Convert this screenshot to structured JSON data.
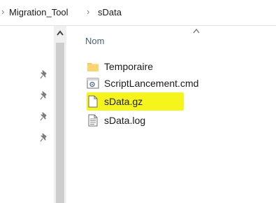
{
  "breadcrumb": {
    "items": [
      "Migration_Tool",
      "sData"
    ],
    "separator": "›"
  },
  "column_header": {
    "label": "Nom"
  },
  "files": [
    {
      "name": "Temporaire",
      "type": "folder-icon"
    },
    {
      "name": "ScriptLancement.cmd",
      "type": "cmd-file-icon"
    },
    {
      "name": "sData.gz",
      "type": "blank-file-icon",
      "highlighted": true
    },
    {
      "name": "sData.log",
      "type": "text-file-icon"
    }
  ],
  "colors": {
    "highlight": "#f5f51b",
    "folder": "#f8c955",
    "header_text": "#4c607a"
  }
}
